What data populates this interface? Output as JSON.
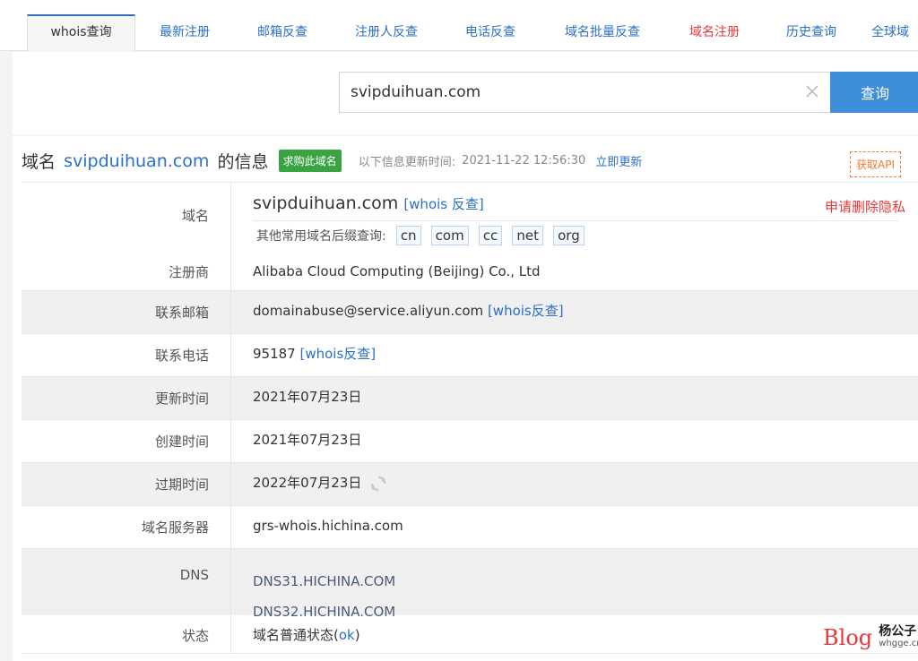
{
  "tabs": [
    {
      "label": "whois查询",
      "active": true
    },
    {
      "label": "最新注册"
    },
    {
      "label": "邮箱反查"
    },
    {
      "label": "注册人反查"
    },
    {
      "label": "电话反查"
    },
    {
      "label": "域名批量反查"
    },
    {
      "label": "域名注册",
      "color": "#e4393c"
    },
    {
      "label": "历史查询"
    },
    {
      "label": "全球域"
    }
  ],
  "search": {
    "value": "svipduihuan.com",
    "button_label": "查询"
  },
  "title": {
    "prefix": "域名",
    "domain": "svipduihuan.com",
    "suffix": "的信息",
    "buy_badge": "求购此域名",
    "update_label": "以下信息更新时间:",
    "update_time": "2021-11-22 12:56:30",
    "update_link": "立即更新",
    "api_button": "获取API"
  },
  "domain_row": {
    "label": "域名",
    "domain": "svipduihuan.com",
    "whois_link": "[whois 反查]",
    "privacy_link": "申请删除隐私",
    "suffix_label": "其他常用域名后缀查询:",
    "suffixes": [
      "cn",
      "com",
      "cc",
      "net",
      "org"
    ],
    "registrar_label": "注册商",
    "registrar": "Alibaba Cloud Computing (Beijing) Co., Ltd"
  },
  "rows": {
    "email": {
      "label": "联系邮箱",
      "value": "domainabuse@service.aliyun.com",
      "link": "[whois反查]"
    },
    "phone": {
      "label": "联系电话",
      "value": "95187",
      "link": "[whois反查]"
    },
    "updated": {
      "label": "更新时间",
      "value": "2021年07月23日"
    },
    "created": {
      "label": "创建时间",
      "value": "2021年07月23日"
    },
    "expires": {
      "label": "过期时间",
      "value": "2022年07月23日"
    },
    "nameserver": {
      "label": "域名服务器",
      "value": "grs-whois.hichina.com"
    },
    "dns": {
      "label": "DNS",
      "values": [
        "DNS31.HICHINA.COM",
        "DNS32.HICHINA.COM"
      ]
    },
    "status": {
      "label": "状态",
      "value_prefix": "域名普通状态(",
      "value_link": "ok",
      "value_suffix": ")"
    }
  },
  "watermark": {
    "blog": "Blog",
    "name": "杨公子",
    "site": "whgge.cn"
  },
  "colors": {
    "link": "#2a6fc9",
    "accent_red": "#e4393c",
    "search_button": "#3e8ed8",
    "badge_green": "#3aa342",
    "api_orange": "#f07b2a"
  }
}
